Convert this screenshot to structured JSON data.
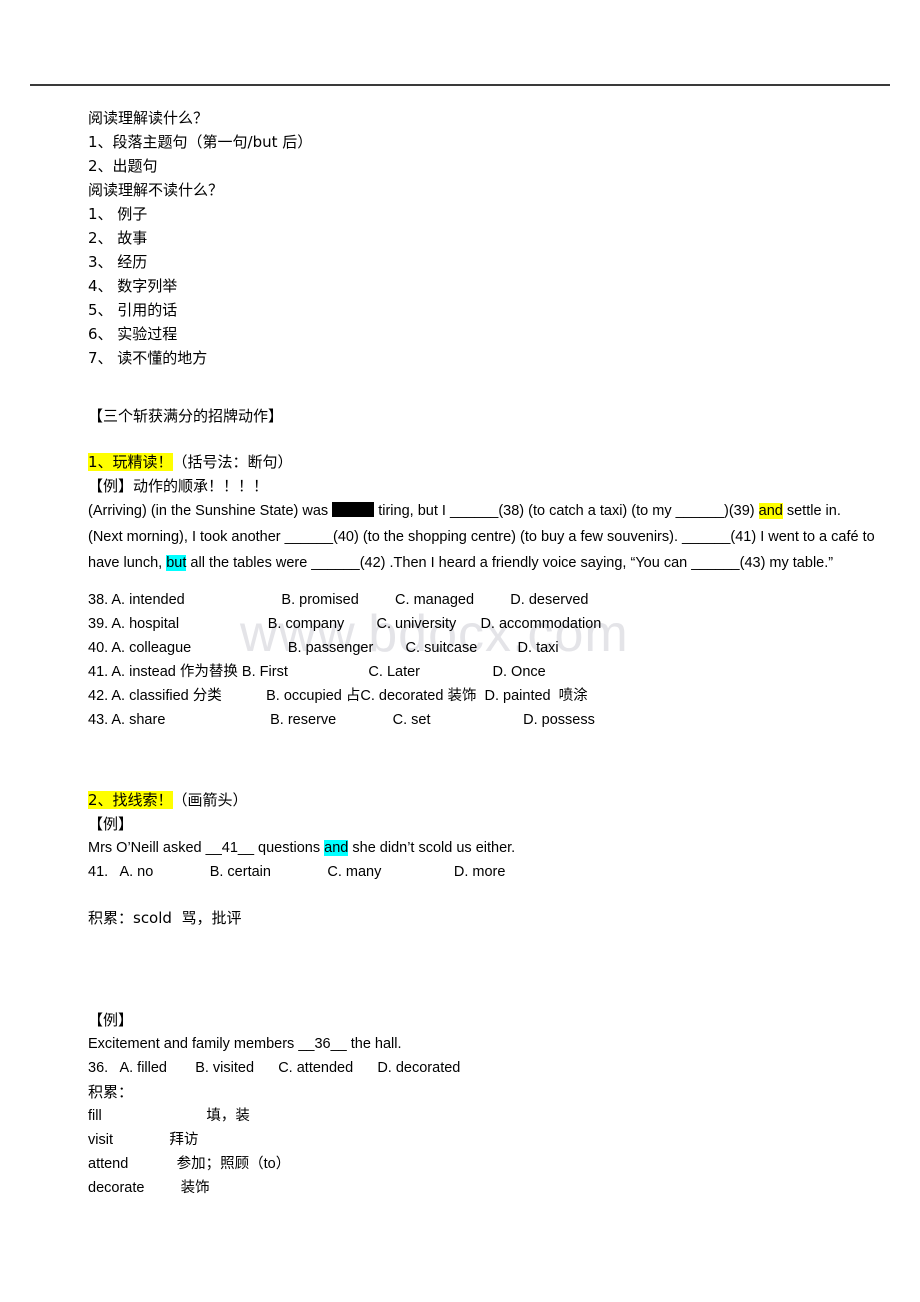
{
  "watermark": {
    "text": "www.bdocx.com"
  },
  "intro": {
    "q1": "阅读理解读什么？",
    "read_items": [
      "1、段落主题句（第一句/but 后）",
      "2、出题句"
    ],
    "q2": "阅读理解不读什么？",
    "skip_items": [
      "1、 例子",
      "2、 故事",
      "3、 经历",
      "4、 数字列举",
      "5、 引用的话",
      "6、 实验过程",
      "7、 读不懂的地方"
    ]
  },
  "main_heading": "【三个斩获满分的招牌动作】",
  "section1": {
    "number_label": "1、玩精读！",
    "paren_note": "（括号法：断句）",
    "example_label": "【例】动作的顺承！！！！",
    "passage": {
      "p1": "(Arriving) (in the Sunshine State) was ",
      "p2": " tiring, but I ______(38) (to catch a taxi) (to my ______)(39) ",
      "hl_and": "and",
      "p3": " settle in. (Next morning), I took another ______(40) (to the shopping centre) (to buy a few souvenirs). ______(41) I went to a café to have lunch, ",
      "hl_but": "but",
      "p4": " all the tables were ______(42) .Then I heard a friendly voice saying, “You can ______(43) my table.”"
    },
    "options": [
      {
        "num": "38.",
        "a": "A. intended",
        "b": "B. promised",
        "c": "C. managed",
        "d": "D. deserved"
      },
      {
        "num": "39.",
        "a": "A. hospital",
        "b": "B. company",
        "c": "C. university",
        "d": "D. accommodation"
      },
      {
        "num": "40.",
        "a": "A. colleague",
        "b": "B. passenger",
        "c": "C. suitcase",
        "d": "D. taxi"
      },
      {
        "num": "41.",
        "a": "A. instead 作为替换",
        "b": "B. First",
        "c": "C. Later",
        "d": "D. Once"
      },
      {
        "num": "42.",
        "a": "A. classified 分类",
        "b": "B. occupied 占",
        "c": "C. decorated 装饰",
        "d": "D. painted  喷涂"
      },
      {
        "num": "43.",
        "a": "A. share",
        "b": "B. reserve",
        "c": "C. set",
        "d": "D. possess"
      }
    ],
    "option_rows_raw": [
      "38. A. intended                        B. promised         C. managed         D. deserved",
      "39. A. hospital                      B. company        C. university      D. accommodation",
      "40. A. colleague                        B. passenger        C. suitcase          D. taxi",
      "41. A. instead 作为替换 B. First                    C. Later                  D. Once",
      "42. A. classified 分类           B. occupied 占C. decorated 装饰  D. painted  喷涂",
      "43. A. share                          B. reserve              C. set                       D. possess"
    ]
  },
  "section2": {
    "number_label": "2、找线索！",
    "paren_note": "（画箭头）",
    "example_label": "【例】",
    "sentence": {
      "before": "Mrs O’Neill asked __41__ questions ",
      "hl_and": "and",
      "after": " she didn’t scold us either."
    },
    "option_row": "41.   A. no              B. certain              C. many                  D. more",
    "note": "积累：scold  骂，批评"
  },
  "section3": {
    "example_label": "【例】",
    "sentence": "Excitement and family members __36__ the hall.",
    "option_row": "36.   A. filled       B. visited      C. attended      D. decorated",
    "note_label": "积累：",
    "vocab": [
      "fill                          填，装",
      "visit              拜访",
      "attend            参加；照顾（to）",
      "decorate         装饰"
    ]
  }
}
